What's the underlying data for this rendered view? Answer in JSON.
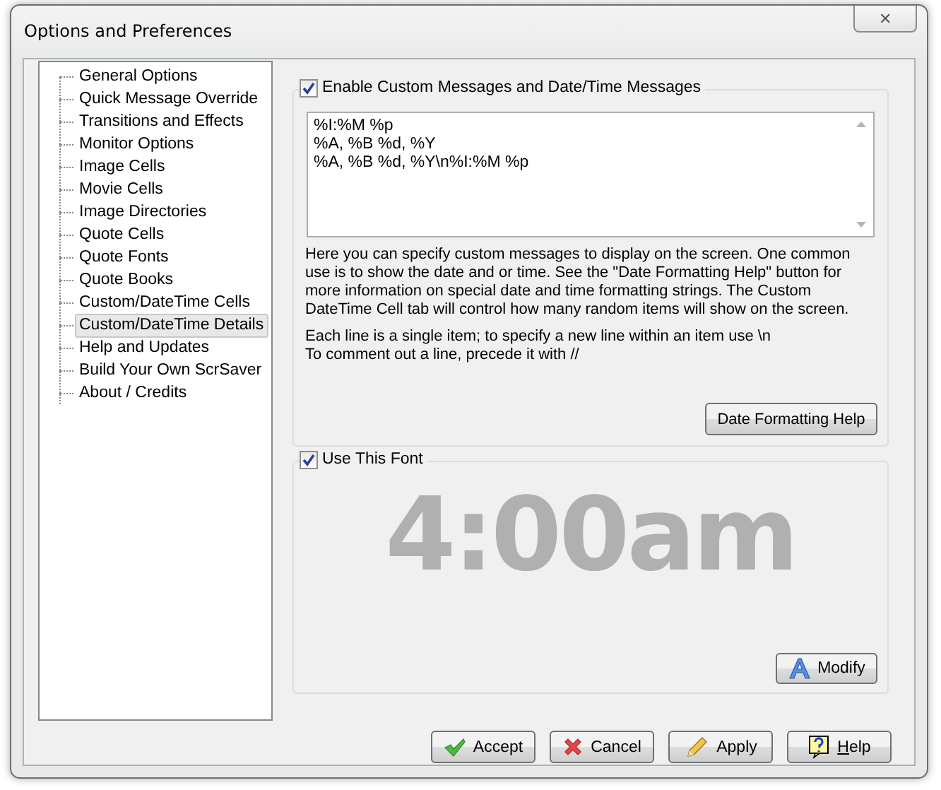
{
  "window": {
    "title": "Options and Preferences",
    "close": "✕"
  },
  "sidebar": {
    "items": [
      {
        "label": "General Options",
        "selected": false
      },
      {
        "label": "Quick Message Override",
        "selected": false
      },
      {
        "label": "Transitions and Effects",
        "selected": false
      },
      {
        "label": "Monitor Options",
        "selected": false
      },
      {
        "label": "Image Cells",
        "selected": false
      },
      {
        "label": "Movie Cells",
        "selected": false
      },
      {
        "label": "Image Directories",
        "selected": false
      },
      {
        "label": "Quote Cells",
        "selected": false
      },
      {
        "label": "Quote Fonts",
        "selected": false
      },
      {
        "label": "Quote Books",
        "selected": false
      },
      {
        "label": "Custom/DateTime Cells",
        "selected": false
      },
      {
        "label": "Custom/DateTime Details",
        "selected": true
      },
      {
        "label": "Help and Updates",
        "selected": false
      },
      {
        "label": "Build Your Own ScrSaver",
        "selected": false
      },
      {
        "label": "About / Credits",
        "selected": false
      }
    ]
  },
  "messages_group": {
    "label": "Enable Custom Messages and Date/Time Messages",
    "checked": true,
    "lines": [
      "%I:%M %p",
      "%A, %B %d, %Y",
      "%A, %B %d, %Y\\n%I:%M %p"
    ],
    "description": [
      "Here you can specify custom messages to display on the screen. One common use is to show the date and or time.  See the \"Date Formatting Help\" button for more information on special date and time formatting strings. The Custom DateTime Cell tab will control how many random items will show on the screen.",
      "Each line is a single item; to specify a new line within an item use \\n\nTo comment out a line, precede it with //"
    ],
    "button": "Date Formatting Help"
  },
  "font_group": {
    "label": "Use This Font",
    "checked": true,
    "preview": "4:00am",
    "button": "Modify"
  },
  "buttons": [
    {
      "label": "Accept",
      "kind": "accept",
      "mnemonic": false
    },
    {
      "label": "Cancel",
      "kind": "cancel",
      "mnemonic": false
    },
    {
      "label": "Apply",
      "kind": "apply",
      "mnemonic": false
    },
    {
      "label": "Help",
      "kind": "help",
      "mnemonic": true
    }
  ]
}
